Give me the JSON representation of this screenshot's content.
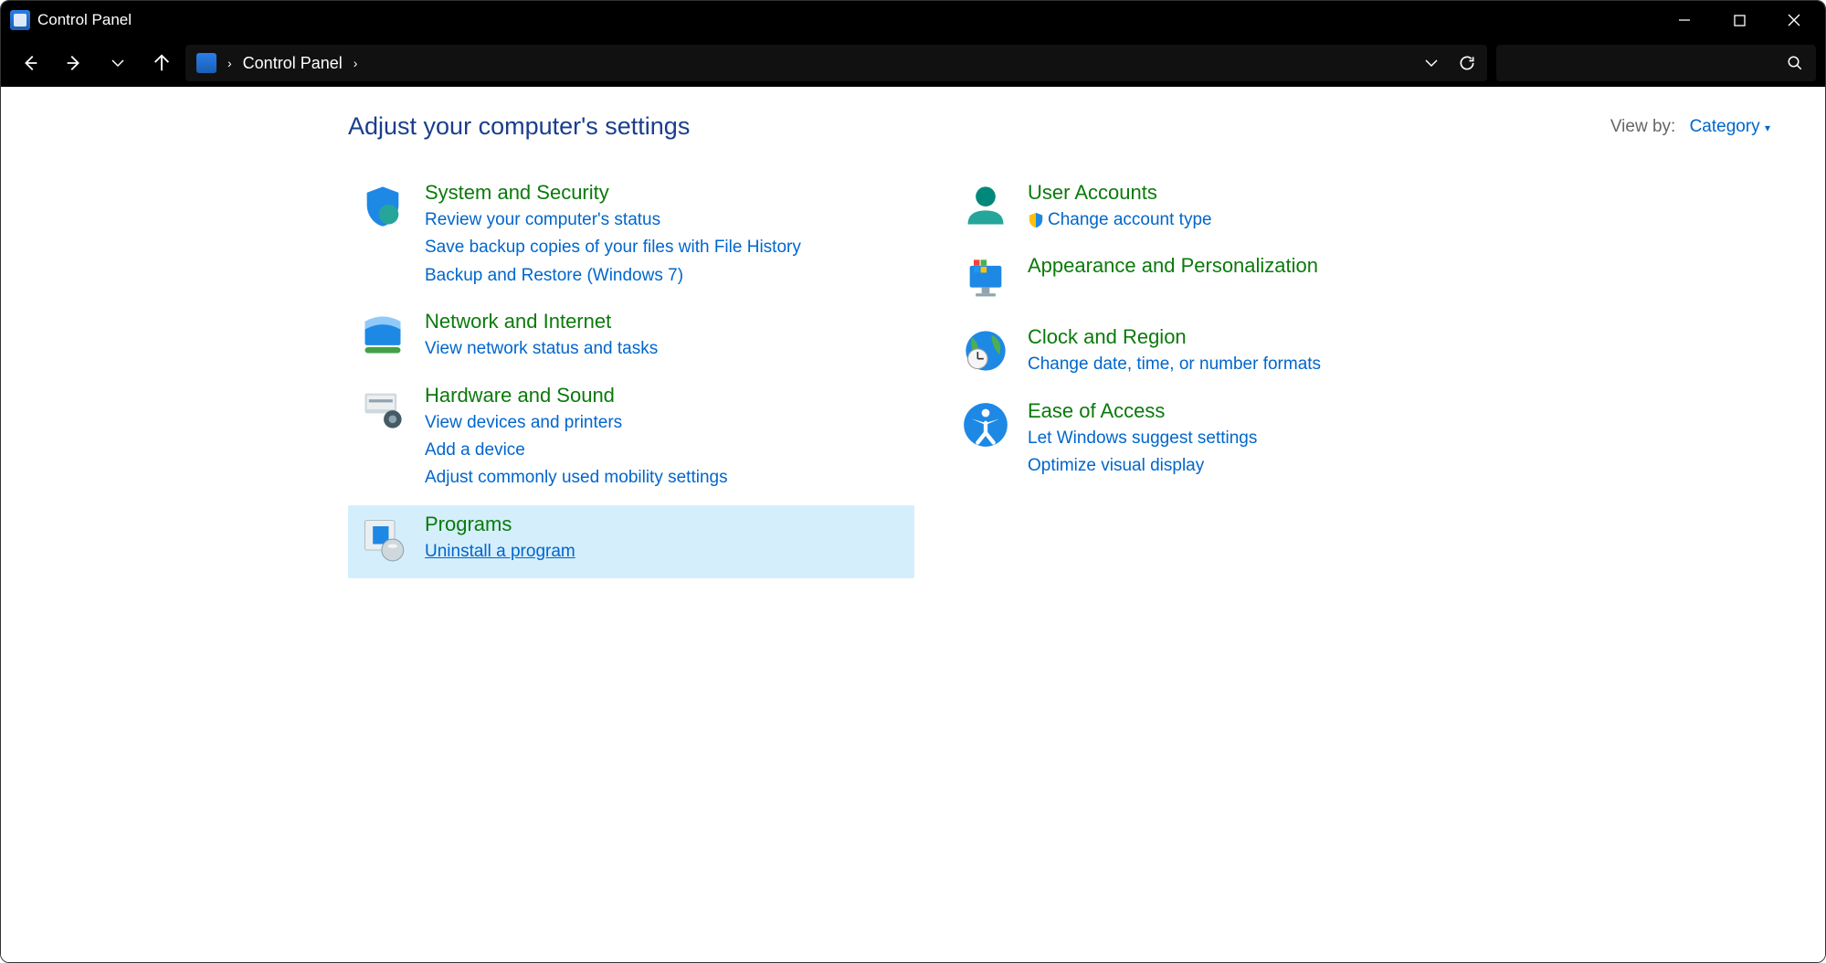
{
  "window": {
    "title": "Control Panel"
  },
  "breadcrumb": {
    "root": "Control Panel"
  },
  "page": {
    "heading": "Adjust your computer's settings",
    "viewby_label": "View by:",
    "viewby_value": "Category"
  },
  "left_col": [
    {
      "id": "system-security",
      "title": "System and Security",
      "links": [
        "Review your computer's status",
        "Save backup copies of your files with File History",
        "Backup and Restore (Windows 7)"
      ]
    },
    {
      "id": "network-internet",
      "title": "Network and Internet",
      "links": [
        "View network status and tasks"
      ]
    },
    {
      "id": "hardware-sound",
      "title": "Hardware and Sound",
      "links": [
        "View devices and printers",
        "Add a device",
        "Adjust commonly used mobility settings"
      ]
    },
    {
      "id": "programs",
      "title": "Programs",
      "hover": true,
      "links": [
        "Uninstall a program"
      ],
      "underline": [
        0
      ]
    }
  ],
  "right_col": [
    {
      "id": "user-accounts",
      "title": "User Accounts",
      "links": [
        "Change account type"
      ],
      "shield": [
        0
      ]
    },
    {
      "id": "appearance",
      "title": "Appearance and Personalization",
      "links": []
    },
    {
      "id": "clock-region",
      "title": "Clock and Region",
      "links": [
        "Change date, time, or number formats"
      ]
    },
    {
      "id": "ease-of-access",
      "title": "Ease of Access",
      "links": [
        "Let Windows suggest settings",
        "Optimize visual display"
      ]
    }
  ]
}
